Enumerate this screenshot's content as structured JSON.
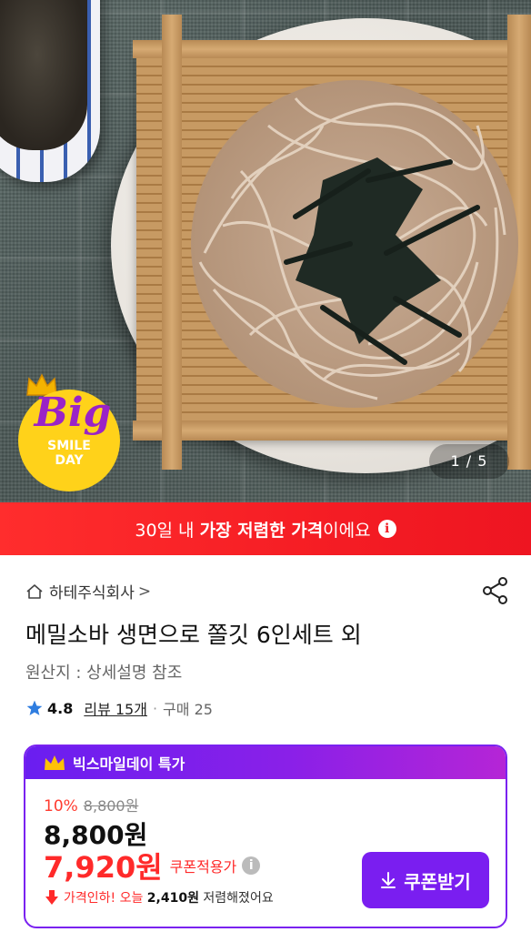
{
  "hero": {
    "counter": "1 / 5",
    "badge": {
      "big": "Big",
      "line1": "SMILE",
      "line2": "DAY"
    }
  },
  "banner": {
    "prefix": "30일 내 ",
    "bold": "가장 저렴한 가격",
    "suffix": "이에요",
    "info_icon": "ℹ"
  },
  "product": {
    "seller": "하테주식회사",
    "seller_chevron": ">",
    "title": "메밀소바 생면으로 쫄깃 6인세트 외",
    "origin": "원산지 : 상세설명 참조",
    "rating": "4.8",
    "reviews": "리뷰 15개",
    "separator": "·",
    "purchases": "구매 25"
  },
  "promo": {
    "header": "빅스마일데이 특가",
    "discount_pct": "10%",
    "original_price": "8,800원",
    "price": "8,800원",
    "coupon_price": "7,920원",
    "coupon_label": "쿠폰적용가",
    "coupon_info_icon": "i",
    "drop_prefix": "가격인하! 오늘 ",
    "drop_amount": "2,410원",
    "drop_suffix": " 저렴해졌어요",
    "coupon_button": "쿠폰받기"
  },
  "colors": {
    "banner_red": "#f51d24",
    "brand_purple": "#7a1ef0",
    "price_red": "#ff2a2a",
    "star_blue": "#2e7de0",
    "badge_yellow": "#ffd21a"
  }
}
